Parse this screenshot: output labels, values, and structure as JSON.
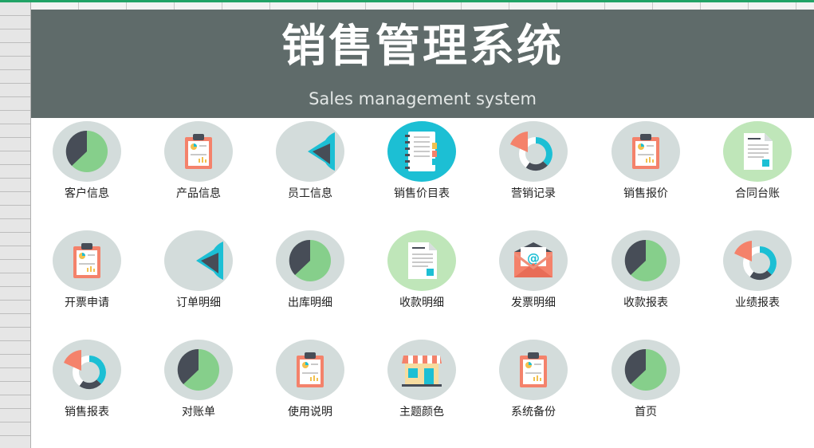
{
  "header": {
    "title": "销售管理系统",
    "subtitle": "Sales management system"
  },
  "colors": {
    "header_bg": "#5f6b6a",
    "icon_circle": "#d3dcdb",
    "teal": "#1cbfd4",
    "pie_green": "#86cf8b",
    "dark_slate": "#474d57",
    "coral": "#f4826b"
  },
  "tiles": [
    {
      "label": "客户信息",
      "icon": "pie-chart-icon"
    },
    {
      "label": "产品信息",
      "icon": "clipboard-report-icon"
    },
    {
      "label": "员工信息",
      "icon": "teal-pie-chart-icon"
    },
    {
      "label": "销售价目表",
      "icon": "notebook-icon"
    },
    {
      "label": "营销记录",
      "icon": "donut-chart-icon"
    },
    {
      "label": "销售报价",
      "icon": "clipboard-report-icon"
    },
    {
      "label": "合同台账",
      "icon": "document-icon"
    },
    {
      "label": "开票申请",
      "icon": "clipboard-report-icon"
    },
    {
      "label": "订单明细",
      "icon": "teal-pie-chart-icon"
    },
    {
      "label": "出库明细",
      "icon": "pie-chart-icon"
    },
    {
      "label": "收款明细",
      "icon": "document-icon"
    },
    {
      "label": "发票明细",
      "icon": "envelope-at-icon"
    },
    {
      "label": "收款报表",
      "icon": "pie-chart-icon"
    },
    {
      "label": "业绩报表",
      "icon": "donut-chart-icon"
    },
    {
      "label": "销售报表",
      "icon": "donut-chart-icon"
    },
    {
      "label": "对账单",
      "icon": "pie-chart-icon"
    },
    {
      "label": "使用说明",
      "icon": "clipboard-report-icon"
    },
    {
      "label": "主题颜色",
      "icon": "storefront-icon"
    },
    {
      "label": "系统备份",
      "icon": "clipboard-report-icon"
    },
    {
      "label": "首页",
      "icon": "pie-chart-icon"
    }
  ]
}
